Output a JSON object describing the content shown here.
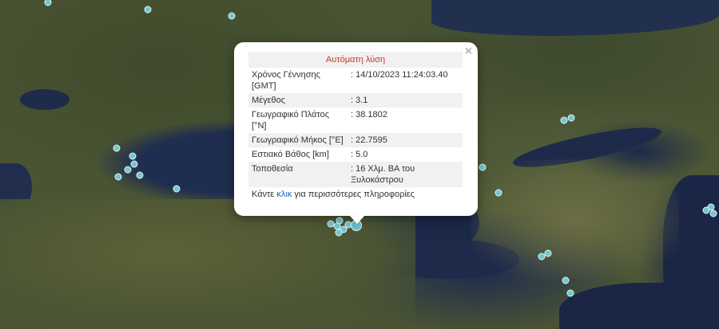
{
  "popup": {
    "title": "Αυτόματη λύση",
    "close_glyph": "×",
    "rows": [
      {
        "label": "Χρόνος Γέννησης [GMT]",
        "value": ": 14/10/2023 11:24:03.40"
      },
      {
        "label": "Μέγεθος",
        "value": ": 3.1"
      },
      {
        "label": "Γεωγραφικό Πλάτος [°N]",
        "value": ": 38.1802"
      },
      {
        "label": "Γεωγραφικό Μήκος [°E]",
        "value": ": 22.7595"
      },
      {
        "label": "Εστιακό Βάθος [km]",
        "value": ": 5.0"
      },
      {
        "label": "Τοποθεσία",
        "value": ": 16 Χλμ. ΒΑ του Ξυλοκάστρου"
      }
    ],
    "more_prefix": "Κάντε ",
    "more_link": "κλικ",
    "more_suffix": " για περισσότερες πληροφορίες"
  },
  "colors": {
    "marker": "#74c6cf",
    "title_red": "#c0392b",
    "link_blue": "#1a5fb4"
  }
}
